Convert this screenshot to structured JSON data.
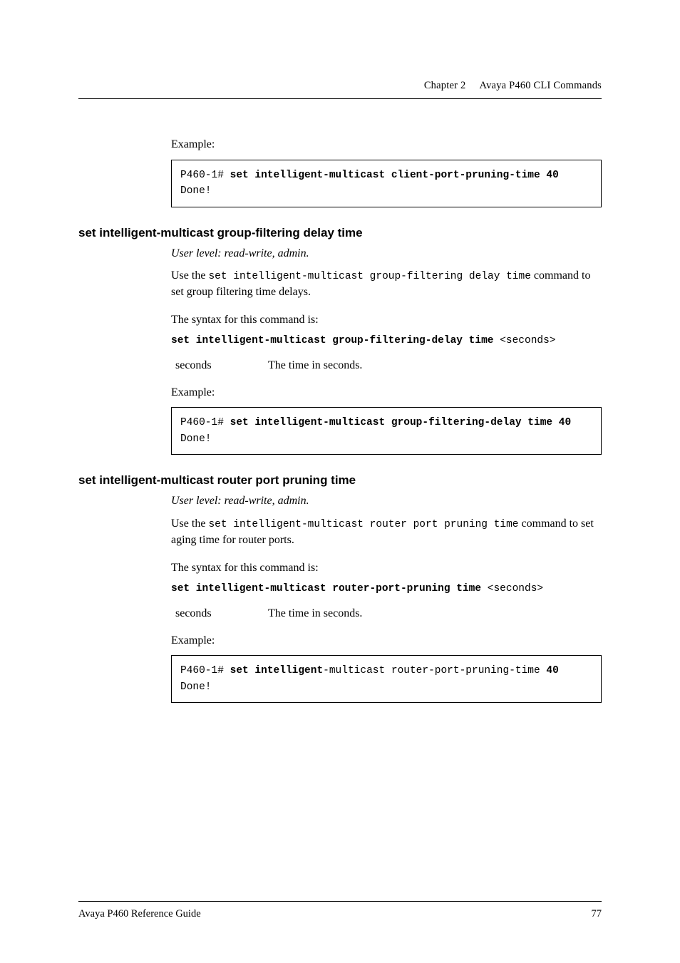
{
  "header": {
    "chapter": "Chapter 2",
    "title": "Avaya P460 CLI Commands"
  },
  "sec_top": {
    "example_label": "Example:",
    "code_prompt": "P460-1# ",
    "code_bold": "set intelligent-multicast client-port-pruning-time 40",
    "code_tail": "Done!"
  },
  "sec_gfd": {
    "heading": "set intelligent-multicast group-filtering delay time",
    "userlevel": "User level: read-write, admin.",
    "use_pre": "Use the ",
    "use_mono": "set intelligent-multicast group-filtering delay time",
    "use_post": " command to set  group filtering time delays.",
    "syntax_intro": "The syntax for this command is:",
    "syntax_bold": "set intelligent-multicast group-filtering-delay time ",
    "syntax_arg": "<seconds>",
    "param_name": "seconds",
    "param_desc": "The time in seconds.",
    "example_label": "Example:",
    "code_prompt": "P460-1# ",
    "code_bold": "set intelligent-multicast group-filtering-delay time 40",
    "code_tail": "Done!"
  },
  "sec_rpp": {
    "heading": "set intelligent-multicast router port pruning time",
    "userlevel": "User level: read-write, admin.",
    "use_pre": "Use the ",
    "use_mono": "set intelligent-multicast router port pruning time",
    "use_post": " command to set aging time for router ports.",
    "syntax_intro": "The syntax for this command is:",
    "syntax_bold": "set intelligent-multicast router-port-pruning time ",
    "syntax_arg": "<seconds>",
    "param_name": "seconds",
    "param_desc": "The time in seconds.",
    "example_label": "Example:",
    "code_prompt": "P460-1# ",
    "code_bold1": "set intelligent",
    "code_plain1": "-multicast router-port-pruning-time ",
    "code_bold2": "40",
    "code_tail": "Done!"
  },
  "footer": {
    "left": "Avaya P460 Reference Guide",
    "page": "77"
  }
}
